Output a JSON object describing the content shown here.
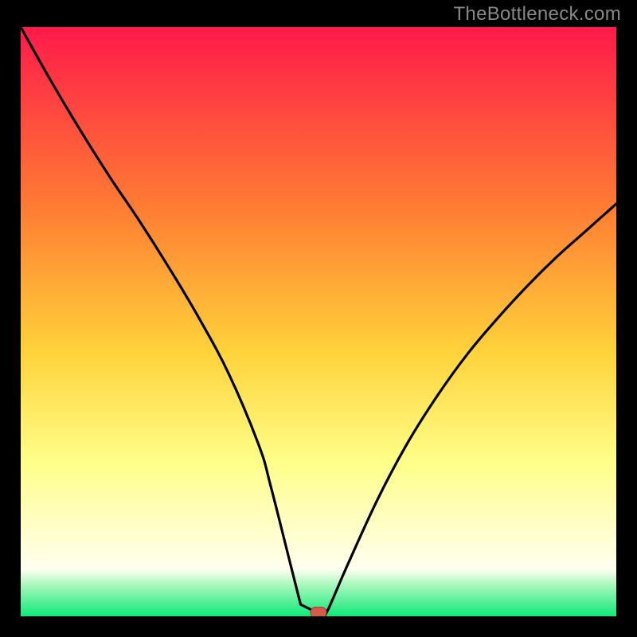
{
  "watermark": "TheBottleneck.com",
  "colors": {
    "gradient_top": "#ff1a4b",
    "gradient_upper_mid": "#ff7a33",
    "gradient_mid": "#ffd23a",
    "gradient_lower_mid": "#ffff8a",
    "gradient_cream": "#fffecd",
    "gradient_mint": "#9ff7b8",
    "gradient_bottom": "#11e87a",
    "curve": "#000000",
    "marker_fill": "#d45a4a",
    "marker_stroke": "#a8362a"
  },
  "chart_data": {
    "type": "line",
    "title": "",
    "xlabel": "",
    "ylabel": "",
    "xlim": [
      0,
      100
    ],
    "ylim": [
      0,
      100
    ],
    "series": [
      {
        "name": "bottleneck-curve",
        "x": [
          0,
          5,
          10,
          15,
          20,
          25,
          30,
          35,
          40,
          42,
          45,
          47,
          48,
          50,
          52,
          55,
          60,
          65,
          70,
          75,
          80,
          85,
          90,
          95,
          100
        ],
        "y": [
          100,
          91,
          82.5,
          74.5,
          67,
          59,
          50.5,
          41,
          29,
          22,
          10,
          2,
          0,
          0,
          2,
          9,
          20,
          29.5,
          37.5,
          44.5,
          50.5,
          56,
          61,
          65.5,
          70
        ]
      }
    ],
    "flat_bottom": {
      "x_start": 47,
      "x_end": 51,
      "y": 0
    },
    "marker": {
      "x": 50,
      "y": 0.6
    },
    "gradient_stops_pct": [
      0,
      30,
      55,
      74,
      86,
      92,
      95,
      100
    ]
  }
}
